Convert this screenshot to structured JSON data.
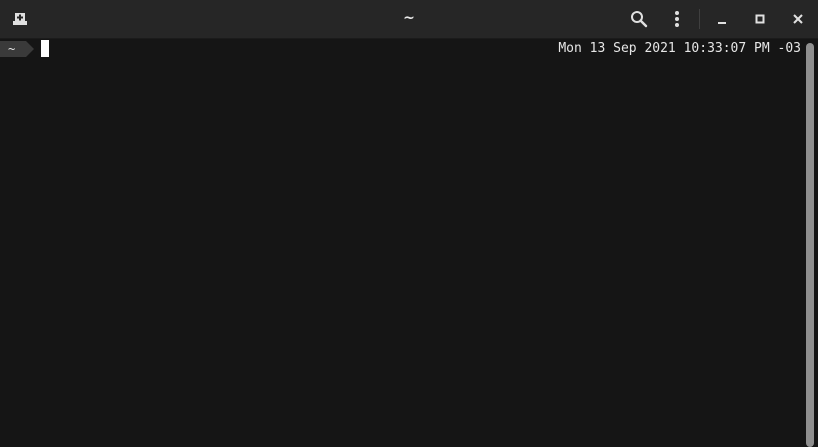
{
  "window": {
    "title": "~"
  },
  "titlebar": {
    "new_tab_icon": "new-tab-icon",
    "search_icon": "search-icon",
    "menu_icon": "kebab-menu-icon",
    "minimize_icon": "minimize-icon",
    "maximize_icon": "maximize-icon",
    "close_icon": "close-icon"
  },
  "terminal": {
    "prompt_dir": "~",
    "clock": "Mon 13 Sep 2021 10:33:07 PM -03"
  },
  "colors": {
    "background": "#151515",
    "titlebar": "#262626",
    "prompt_segment": "#3a3a3a",
    "text": "#e6e6e6",
    "scrollbar_thumb": "#8f8f8f"
  }
}
